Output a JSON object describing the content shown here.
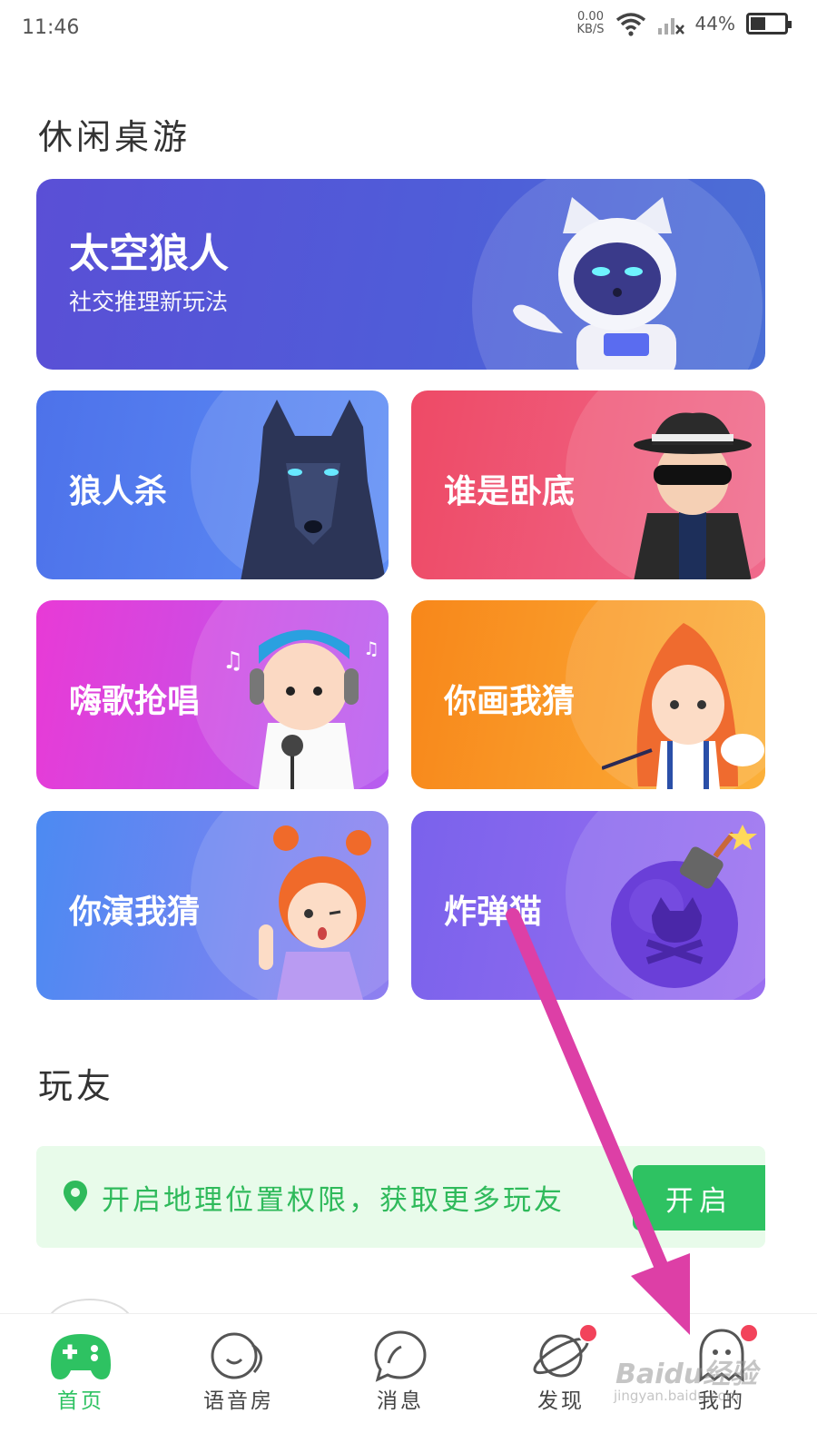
{
  "status_bar": {
    "time": "11:46",
    "net_speed": "0.00",
    "net_unit": "KB/S",
    "battery_percent": "44%",
    "battery_level": 0.44
  },
  "sections": {
    "games_title": "休闲桌游",
    "friends_title": "玩友"
  },
  "games": {
    "space_werewolf": {
      "title": "太空狼人",
      "subtitle": "社交推理新玩法"
    },
    "werewolf": {
      "title": "狼人杀"
    },
    "undercover": {
      "title": "谁是卧底"
    },
    "sing": {
      "title": "嗨歌抢唱"
    },
    "draw_guess": {
      "title": "你画我猜"
    },
    "act_guess": {
      "title": "你演我猜"
    },
    "bomb_cat": {
      "title": "炸弹猫"
    }
  },
  "location": {
    "text": "开启地理位置权限，获取更多玩友",
    "button": "开启"
  },
  "tabs": [
    {
      "label": "首页",
      "icon": "gamepad-icon",
      "active": true
    },
    {
      "label": "语音房",
      "icon": "voice-room-icon"
    },
    {
      "label": "消息",
      "icon": "message-icon"
    },
    {
      "label": "发现",
      "icon": "planet-icon",
      "badge": true
    },
    {
      "label": "我的",
      "icon": "ghost-icon",
      "badge": true
    }
  ],
  "watermark": {
    "brand": "Baidu经验",
    "url": "jingyan.baidu.com"
  },
  "colors": {
    "accent": "#2ec262",
    "badge": "#f2435b",
    "arrow": "#dd3fa6"
  }
}
